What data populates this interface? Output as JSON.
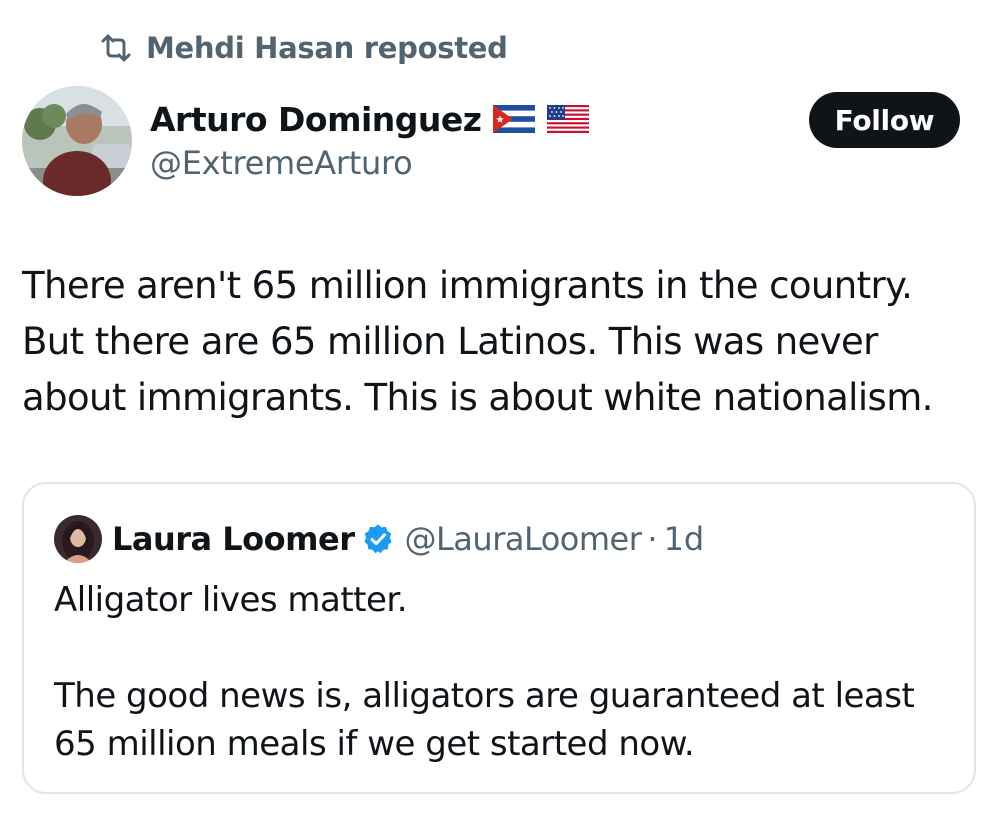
{
  "repost": {
    "label": "Mehdi Hasan reposted",
    "icon": "repost-icon"
  },
  "author": {
    "name": "Arturo Dominguez",
    "handle": "@ExtremeArturo",
    "flags": [
      "cuba-flag-icon",
      "usa-flag-icon"
    ]
  },
  "follow_button": {
    "label": "Follow"
  },
  "tweet": {
    "lines": [
      "There aren't 65 million immigrants in the country.",
      "But there are 65 million Latinos. This was never",
      "about immigrants. This is about white nationalism."
    ]
  },
  "quote": {
    "name": "Laura Loomer",
    "handle": "@LauraLoomer",
    "separator": "·",
    "time": "1d",
    "verified_icon": "verified-badge-icon",
    "paragraph1": "Alligator lives matter.",
    "paragraph2_lines": [
      "The good news is, alligators are guaranteed at least",
      "65 million meals if we get started now."
    ]
  },
  "colors": {
    "text_primary": "#0f1419",
    "text_secondary": "#536471",
    "verified_blue": "#1d9bf0",
    "follow_bg": "#0f1419",
    "card_border": "#e1e6ea"
  }
}
